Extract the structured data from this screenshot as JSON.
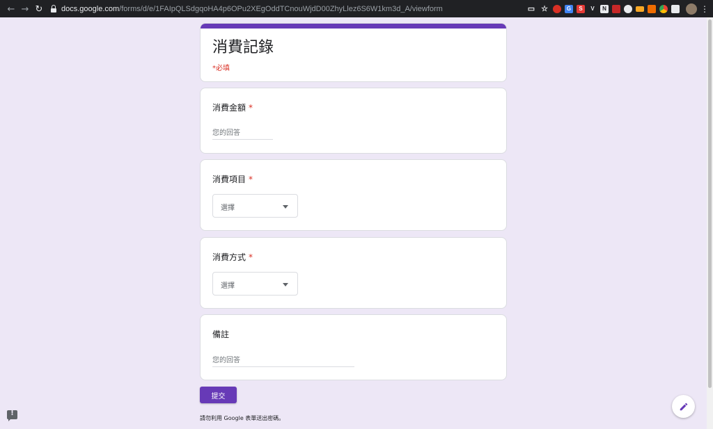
{
  "browser": {
    "url_host": "docs.google.com",
    "url_path": "/forms/d/e/1FAIpQLSdgqoHA4p6OPu2XEgOddTCnouWjdD00ZhyLlez6S6W1km3d_A/viewform",
    "icons": {
      "back": "arrow-left-icon",
      "forward": "arrow-right-icon",
      "reload": "reload-icon",
      "lock": "lock-icon",
      "cast": "cast-icon",
      "bookmark": "star-icon",
      "menu": "more-vert-icon"
    },
    "extensions": [
      {
        "name": "ext-red-shield-icon",
        "color": "#d93025",
        "glyph": "●"
      },
      {
        "name": "ext-translate-icon",
        "color": "#4285f4",
        "glyph": "G"
      },
      {
        "name": "ext-s-icon",
        "color": "#e53935",
        "glyph": "S"
      },
      {
        "name": "ext-v-icon",
        "color": "#202124",
        "glyph": "V"
      },
      {
        "name": "ext-notion-icon",
        "color": "#202124",
        "glyph": "N"
      },
      {
        "name": "ext-book-icon",
        "color": "#c62828",
        "glyph": "▮"
      },
      {
        "name": "ext-github-icon",
        "color": "#202124",
        "glyph": "◉"
      },
      {
        "name": "ext-mail-icon",
        "color": "#f9a825",
        "glyph": "▬"
      },
      {
        "name": "ext-fox-icon",
        "color": "#ef6c00",
        "glyph": "◆"
      },
      {
        "name": "ext-chrome-icon",
        "color": "#34a853",
        "glyph": "◎"
      },
      {
        "name": "ext-chat-icon",
        "color": "#9e9e9e",
        "glyph": "■"
      }
    ]
  },
  "form": {
    "title": "消費記錄",
    "required_note": "*必填",
    "questions": [
      {
        "label": "消費金額",
        "required_mark": "*",
        "answer_placeholder": "您的回答"
      },
      {
        "label": "消費項目",
        "required_mark": "*",
        "dropdown_label": "選擇"
      },
      {
        "label": "消費方式",
        "required_mark": "*",
        "dropdown_label": "選擇"
      },
      {
        "label": "備註",
        "answer_placeholder": "您的回答"
      }
    ],
    "submit_label": "提交",
    "footer_note": "請勿利用 Google 表單送出密碼。"
  },
  "colors": {
    "accent": "#673ab7",
    "page_background": "#ede7f6",
    "required": "#d93025"
  },
  "icons": {
    "report": "report-problem-icon",
    "edit": "pencil-icon"
  }
}
